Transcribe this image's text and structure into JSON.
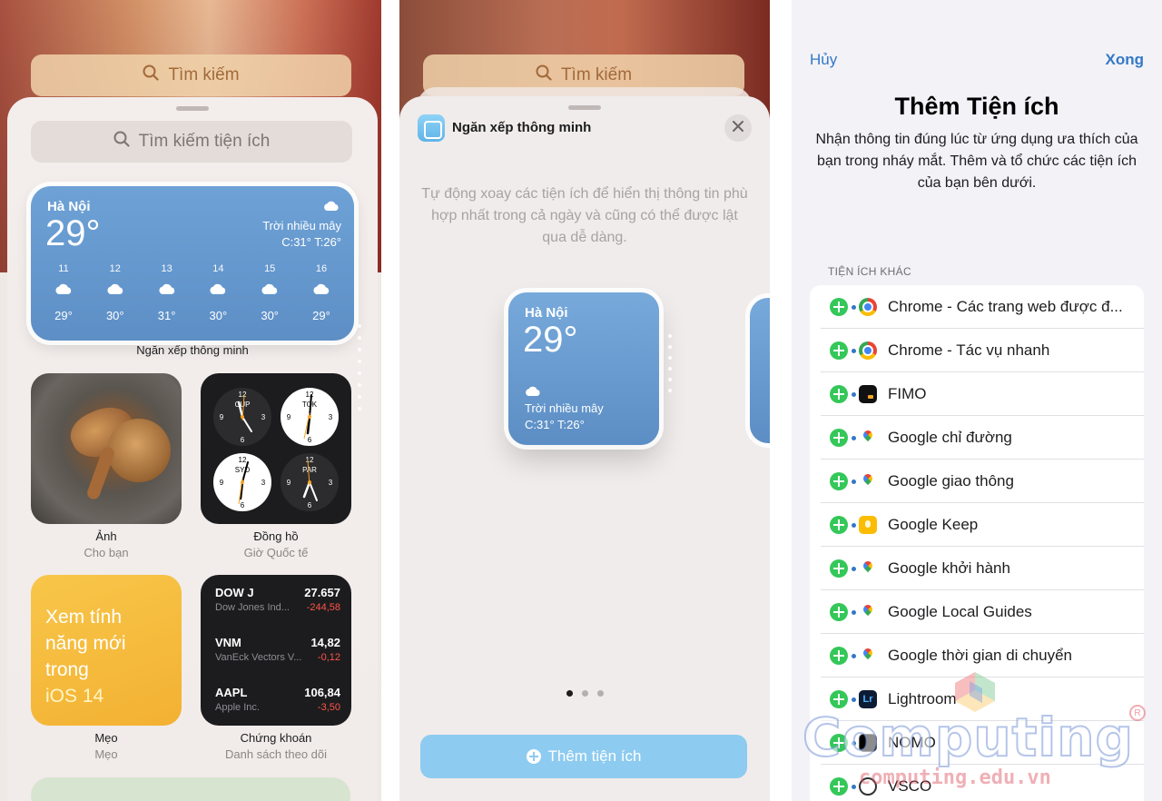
{
  "panel1": {
    "top_search": "Tìm kiếm",
    "gallery_search": "Tìm kiếm tiện ích",
    "weather": {
      "city": "Hà Nội",
      "temp": "29°",
      "condition": "Trời nhiều mây",
      "high_low": "C:31° T:26°",
      "hours": [
        {
          "h": "11",
          "t": "29°"
        },
        {
          "h": "12",
          "t": "30°"
        },
        {
          "h": "13",
          "t": "31°"
        },
        {
          "h": "14",
          "t": "30°"
        },
        {
          "h": "15",
          "t": "30°"
        },
        {
          "h": "16",
          "t": "29°"
        }
      ]
    },
    "weather_caption": "Ngăn xếp thông minh",
    "photos": {
      "title": "Ảnh",
      "subtitle": "Cho bạn"
    },
    "clock": {
      "title": "Đồng hồ",
      "subtitle": "Giờ Quốc tế",
      "cities": [
        "CUP",
        "TOK",
        "SYD",
        "PAR"
      ]
    },
    "tips": {
      "line1": "Xem tính",
      "line2": "năng mới",
      "line3": "trong",
      "line4": "iOS 14",
      "title": "Mẹo",
      "subtitle": "Mẹo"
    },
    "stocks": {
      "title": "Chứng khoán",
      "subtitle": "Danh sách theo dõi",
      "rows": [
        {
          "sym": "DOW J",
          "name": "Dow Jones Ind...",
          "price": "27.657",
          "change": "-244,58"
        },
        {
          "sym": "VNM",
          "name": "VanEck Vectors V...",
          "price": "14,82",
          "change": "-0,12"
        },
        {
          "sym": "AAPL",
          "name": "Apple Inc.",
          "price": "106,84",
          "change": "-3,50"
        }
      ]
    }
  },
  "panel2": {
    "top_search": "Tìm kiếm",
    "title": "Ngăn xếp thông minh",
    "description": "Tự động xoay các tiện ích để hiển thị thông tin phù hợp nhất trong cả ngày và cũng có thể được lật qua dễ dàng.",
    "weather": {
      "city": "Hà Nội",
      "temp": "29°",
      "condition": "Trời nhiều mây",
      "high_low": "C:31° T:26°"
    },
    "add_button": "Thêm tiện ích"
  },
  "panel3": {
    "cancel": "Hủy",
    "done": "Xong",
    "title": "Thêm Tiện ích",
    "description": "Nhận thông tin đúng lúc từ ứng dụng ưa thích của bạn trong nháy mắt. Thêm và tổ chức các tiện ích của bạn bên dưới.",
    "section_header": "TIỆN ÍCH KHÁC",
    "items": [
      {
        "label": "Chrome - Các trang web được đ...",
        "icon": "chrome-icon"
      },
      {
        "label": "Chrome - Tác vụ nhanh",
        "icon": "chrome-icon"
      },
      {
        "label": "FIMO",
        "icon": "fimo-icon"
      },
      {
        "label": "Google chỉ đường",
        "icon": "google-maps-icon"
      },
      {
        "label": "Google giao thông",
        "icon": "google-maps-icon"
      },
      {
        "label": "Google Keep",
        "icon": "google-keep-icon"
      },
      {
        "label": "Google khởi hành",
        "icon": "google-maps-icon"
      },
      {
        "label": "Google Local Guides",
        "icon": "google-maps-icon"
      },
      {
        "label": "Google thời gian di chuyển",
        "icon": "google-maps-icon"
      },
      {
        "label": "Lightroom",
        "icon": "lightroom-icon"
      },
      {
        "label": "NOMO",
        "icon": "nomo-icon"
      },
      {
        "label": "VSCO",
        "icon": "vsco-icon"
      }
    ]
  },
  "watermark": {
    "brand": "Computing",
    "url": "computing.edu.vn"
  },
  "colors": {
    "accent_blue": "#3478c6",
    "add_green": "#34c759",
    "stock_red": "#ff5449",
    "weather_blue": "#5d8fc6",
    "tips_yellow": "#f3b132"
  }
}
